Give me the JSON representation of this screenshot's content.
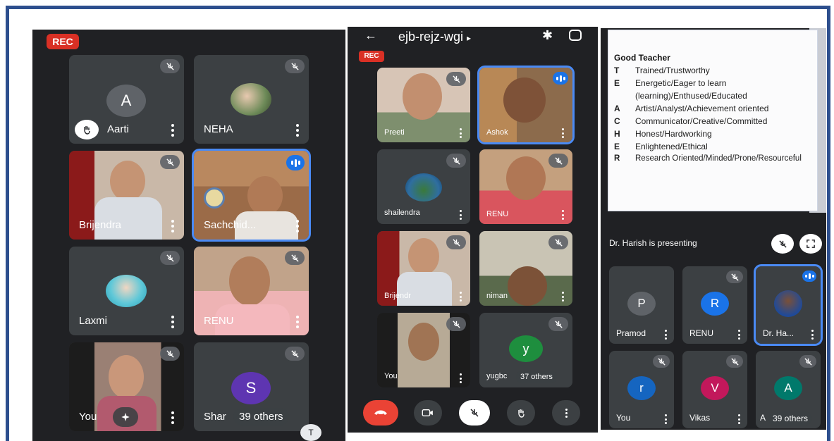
{
  "screen1": {
    "rec_label": "REC",
    "tiles": [
      {
        "name": "Aarti",
        "avatar_letter": "A",
        "avatar_color": "#5f6368"
      },
      {
        "name": "NEHA"
      },
      {
        "name": "Brijendra"
      },
      {
        "name": "Sachchid..."
      },
      {
        "name": "Laxmi"
      },
      {
        "name": "RENU"
      },
      {
        "name": "You"
      },
      {
        "name": "Shar",
        "avatar_letter": "S",
        "avatar_color": "#5e35b1",
        "others": "39 others"
      }
    ]
  },
  "screen2": {
    "header_title": "ejb-rejz-wgi",
    "header_arrow": "▸",
    "rec_label": "REC",
    "tiles": [
      {
        "name": "Preeti"
      },
      {
        "name": "Ashok"
      },
      {
        "name": "shailendra"
      },
      {
        "name": "RENU"
      },
      {
        "name": "Brijendr"
      },
      {
        "name": "niman"
      },
      {
        "name": "You"
      },
      {
        "name": "yugbc",
        "avatar_letter": "y",
        "avatar_color": "#1e8e3e",
        "others": "37 others"
      }
    ]
  },
  "screen3": {
    "slide": {
      "heading": "Good Teacher",
      "rows": [
        {
          "letter": "T",
          "text": "Trained/Trustworthy"
        },
        {
          "letter": "E",
          "text": "Energetic/Eager to learn"
        },
        {
          "letter": "",
          "text": "(learning)/Enthused/Educated"
        },
        {
          "letter": "A",
          "text": "Artist/Analyst/Achievement oriented"
        },
        {
          "letter": "C",
          "text": "Communicator/Creative/Committed"
        },
        {
          "letter": "H",
          "text": "Honest/Hardworking"
        },
        {
          "letter": "E",
          "text": "Enlightened/Ethical"
        },
        {
          "letter": "R",
          "text": "Research Oriented/Minded/Prone/Resourceful"
        }
      ]
    },
    "presenting_label": "Dr. Harish is presenting",
    "tiles": [
      {
        "name": "Pramod",
        "avatar_letter": "P",
        "avatar_color": "#5f6368"
      },
      {
        "name": "RENU",
        "avatar_letter": "R",
        "avatar_color": "#1a73e8"
      },
      {
        "name": "Dr. Ha..."
      },
      {
        "name": "You",
        "avatar_letter": "r",
        "avatar_color": "#1565c0"
      },
      {
        "name": "Vikas",
        "avatar_letter": "V",
        "avatar_color": "#c2185b"
      },
      {
        "name": "A",
        "avatar_letter": "A",
        "avatar_color": "#00796b",
        "others": "39 others"
      }
    ]
  },
  "colors": {
    "accent": "#1a73e8",
    "rec": "#d93025",
    "frame": "#2d4f8e"
  }
}
